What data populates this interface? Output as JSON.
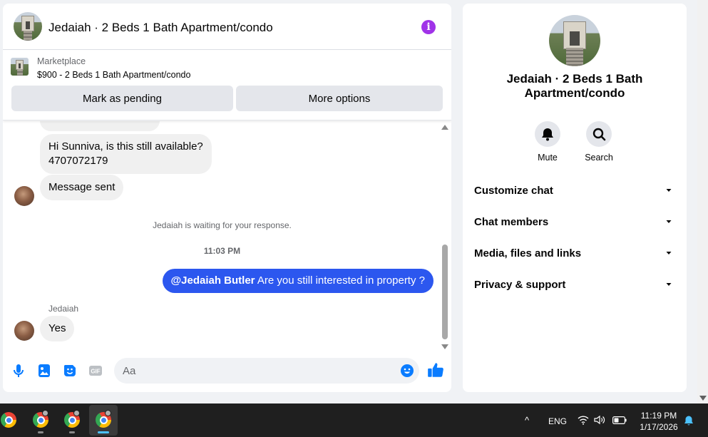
{
  "header": {
    "title": "Jedaiah · 2 Beds 1 Bath Apartment/condo",
    "info_icon": "i"
  },
  "marketplace": {
    "source": "Marketplace",
    "listing": "$900 - 2 Beds 1 Bath Apartment/condo",
    "buttons": {
      "pending": "Mark as pending",
      "more": "More options"
    }
  },
  "messages": {
    "availability": [
      "Hi Sunniva, is this still available?",
      "4707072179"
    ],
    "sent": "Message sent",
    "waiting": "Jedaiah is waiting for your response.",
    "timestamp": "11:03 PM",
    "outgoing": {
      "mention": "@Jedaiah Butler",
      "text": " Are you still interested in property ?"
    },
    "sender_name": "Jedaiah",
    "reply": "Yes"
  },
  "composer": {
    "placeholder": "Aa",
    "icons": [
      "mic-icon",
      "photo-icon",
      "sticker-icon",
      "gif-icon",
      "emoji-icon",
      "like-icon"
    ],
    "gif_label": "GIF"
  },
  "info_panel": {
    "name": "Jedaiah · 2 Beds 1 Bath Apartment/condo",
    "actions": {
      "mute": "Mute",
      "search": "Search"
    },
    "sections": [
      "Customize chat",
      "Chat members",
      "Media, files and links",
      "Privacy & support"
    ]
  },
  "taskbar": {
    "tray_chevron": "^",
    "language": "ENG",
    "time": "11:19 PM",
    "date": "1/17/2026"
  },
  "colors": {
    "accent": "#2c57ef",
    "info": "#a033e8",
    "icon_blue": "#0a7cff"
  }
}
